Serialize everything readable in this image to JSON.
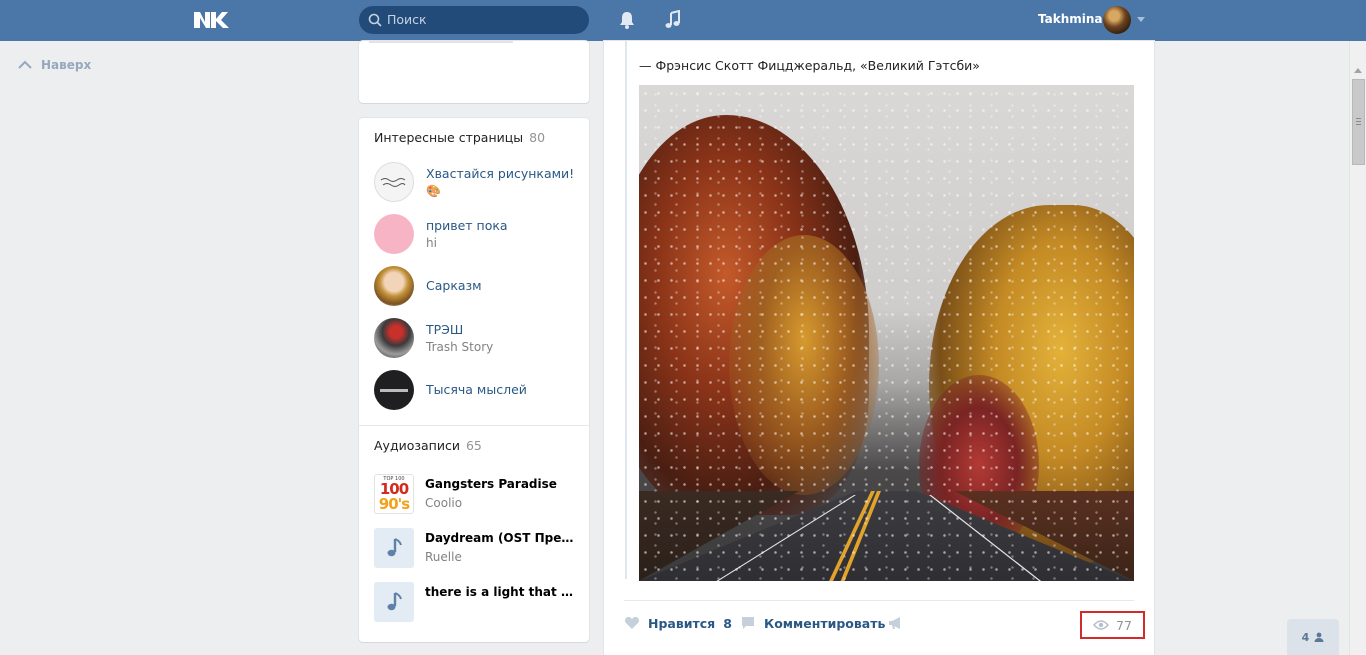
{
  "header": {
    "search_placeholder": "Поиск",
    "user_name": "Takhmina"
  },
  "left_nav": {
    "to_top": "Наверх"
  },
  "interesting_pages": {
    "title": "Интересные страницы",
    "count": "80",
    "items": [
      {
        "name": "Хвастайся рисунками!",
        "sub": "🎨"
      },
      {
        "name": "привет пока",
        "sub": "hi"
      },
      {
        "name": "Сарказм",
        "sub": ""
      },
      {
        "name": "ТРЭШ",
        "sub": "Trash Story"
      },
      {
        "name": "Тысяча мыслей",
        "sub": ""
      }
    ]
  },
  "audio": {
    "title": "Аудиозаписи",
    "count": "65",
    "items": [
      {
        "title": "Gangsters Paradise",
        "artist": "Coolio",
        "cover_text_top": "TOP 100",
        "cover_text_1": "100",
        "cover_text_2": "90's"
      },
      {
        "title": "Daydream (OST Прежде чем я упаду)",
        "artist": "Ruelle"
      },
      {
        "title": "there is a light that will never go out",
        "artist": ""
      }
    ]
  },
  "post": {
    "quote_author": "— Фрэнсис Скотт Фицджеральд, «Великий Гэтсби»",
    "like_label": "Нравится",
    "like_count": "8",
    "comment_label": "Комментировать",
    "views": "77"
  },
  "friends_online": {
    "count": "4"
  },
  "colors": {
    "header": "#4a76a8",
    "link": "#2a5885",
    "background": "#edeef0",
    "highlight_box": "#d32a2a"
  }
}
